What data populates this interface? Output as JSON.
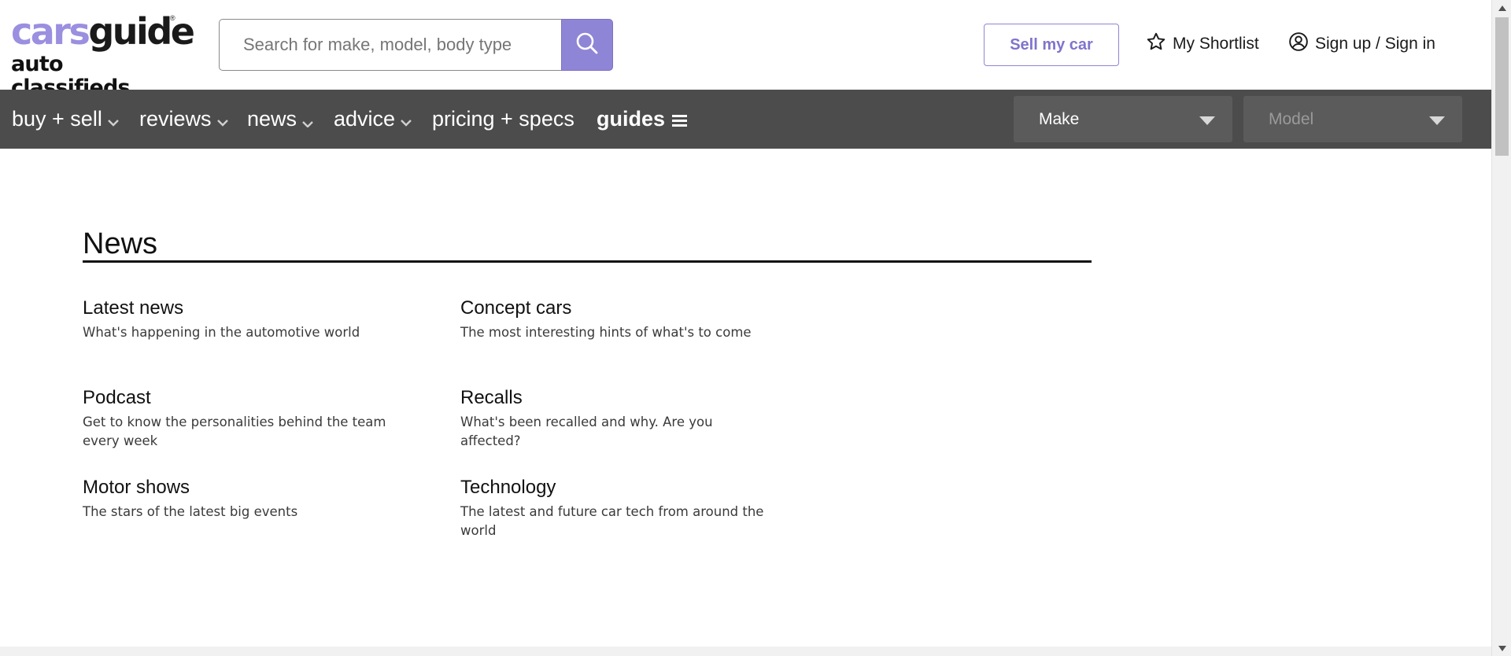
{
  "header": {
    "logo_cars": "cars",
    "logo_guide": "guide",
    "logo_reg": "®",
    "logo_sub": "auto classifieds",
    "search_placeholder": "Search for make, model, body type",
    "sell_label": "Sell my car",
    "shortlist_label": "My Shortlist",
    "signin_label": "Sign up / Sign in"
  },
  "nav": {
    "items": [
      {
        "label": "buy + sell",
        "has_dropdown": true
      },
      {
        "label": "reviews",
        "has_dropdown": true
      },
      {
        "label": "news",
        "has_dropdown": true
      },
      {
        "label": "advice",
        "has_dropdown": true
      },
      {
        "label": "pricing + specs",
        "has_dropdown": false
      }
    ],
    "guides_label": "guides",
    "make_label": "Make",
    "model_label": "Model"
  },
  "main": {
    "title": "News",
    "cards": [
      {
        "title": "Latest news",
        "desc": "What's happening in the automotive world"
      },
      {
        "title": "Concept cars",
        "desc": "The most interesting hints of what's to come"
      },
      {
        "title": "Podcast",
        "desc": "Get to know the personalities behind the team every week"
      },
      {
        "title": "Recalls",
        "desc": "What's been recalled and why. Are you affected?"
      },
      {
        "title": "Motor shows",
        "desc": "The stars of the latest big events"
      },
      {
        "title": "Technology",
        "desc": "The latest and future car tech from around the world"
      }
    ]
  },
  "colors": {
    "brand_purple": "#8f85d6",
    "nav_bg": "#4c4c4c",
    "select_bg": "#5b5b5b"
  },
  "icons": {
    "search": "search-icon",
    "shortlist": "star-icon",
    "signin": "user-circle-icon",
    "dropdown": "chevron-down-icon",
    "guides": "menu-icon",
    "select": "caret-down-icon"
  }
}
